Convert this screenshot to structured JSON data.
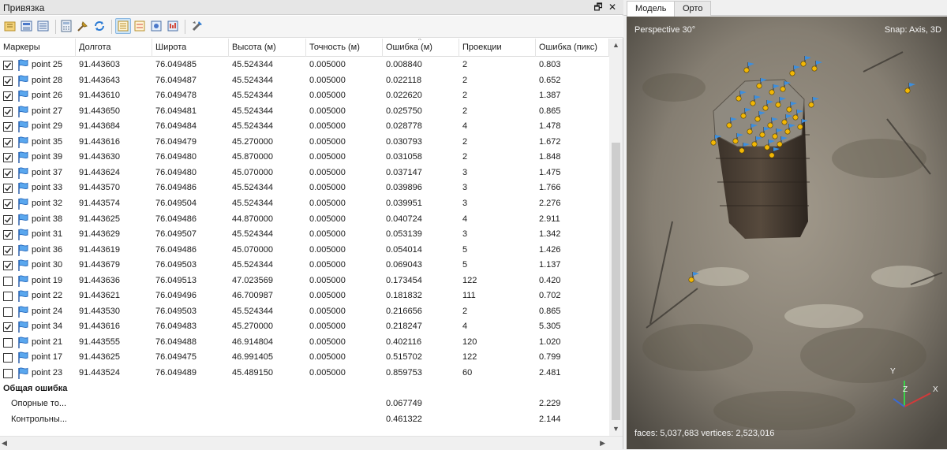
{
  "panel": {
    "title": "Привязка",
    "float_glyph": "🗗",
    "close_glyph": "✕"
  },
  "toolbar": {
    "icons": [
      "import-icon",
      "export-icon",
      "export-markers-icon",
      "calculator-icon",
      "pin-icon",
      "refresh-icon",
      "markers-view-icon",
      "scale-bars-view-icon",
      "cameras-view-icon",
      "view-errors-icon",
      "settings-icon"
    ]
  },
  "table": {
    "columns": [
      "Маркеры",
      "Долгота",
      "Широта",
      "Высота (м)",
      "Точность (м)",
      "Ошибка (м)",
      "Проекции",
      "Ошибка (пикс)"
    ],
    "rows": [
      {
        "checked": true,
        "name": "point 25",
        "lon": "91.443603",
        "lat": "76.049485",
        "alt": "45.524344",
        "acc": "0.005000",
        "err": "0.008840",
        "proj": "2",
        "pix": "0.803"
      },
      {
        "checked": true,
        "name": "point 28",
        "lon": "91.443643",
        "lat": "76.049487",
        "alt": "45.524344",
        "acc": "0.005000",
        "err": "0.022118",
        "proj": "2",
        "pix": "0.652"
      },
      {
        "checked": true,
        "name": "point 26",
        "lon": "91.443610",
        "lat": "76.049478",
        "alt": "45.524344",
        "acc": "0.005000",
        "err": "0.022620",
        "proj": "2",
        "pix": "1.387"
      },
      {
        "checked": true,
        "name": "point 27",
        "lon": "91.443650",
        "lat": "76.049481",
        "alt": "45.524344",
        "acc": "0.005000",
        "err": "0.025750",
        "proj": "2",
        "pix": "0.865"
      },
      {
        "checked": true,
        "name": "point 29",
        "lon": "91.443684",
        "lat": "76.049484",
        "alt": "45.524344",
        "acc": "0.005000",
        "err": "0.028778",
        "proj": "4",
        "pix": "1.478"
      },
      {
        "checked": true,
        "name": "point 35",
        "lon": "91.443616",
        "lat": "76.049479",
        "alt": "45.270000",
        "acc": "0.005000",
        "err": "0.030793",
        "proj": "2",
        "pix": "1.672"
      },
      {
        "checked": true,
        "name": "point 39",
        "lon": "91.443630",
        "lat": "76.049480",
        "alt": "45.870000",
        "acc": "0.005000",
        "err": "0.031058",
        "proj": "2",
        "pix": "1.848"
      },
      {
        "checked": true,
        "name": "point 37",
        "lon": "91.443624",
        "lat": "76.049480",
        "alt": "45.070000",
        "acc": "0.005000",
        "err": "0.037147",
        "proj": "3",
        "pix": "1.475"
      },
      {
        "checked": true,
        "name": "point 33",
        "lon": "91.443570",
        "lat": "76.049486",
        "alt": "45.524344",
        "acc": "0.005000",
        "err": "0.039896",
        "proj": "3",
        "pix": "1.766"
      },
      {
        "checked": true,
        "name": "point 32",
        "lon": "91.443574",
        "lat": "76.049504",
        "alt": "45.524344",
        "acc": "0.005000",
        "err": "0.039951",
        "proj": "3",
        "pix": "2.276"
      },
      {
        "checked": true,
        "name": "point 38",
        "lon": "91.443625",
        "lat": "76.049486",
        "alt": "44.870000",
        "acc": "0.005000",
        "err": "0.040724",
        "proj": "4",
        "pix": "2.911"
      },
      {
        "checked": true,
        "name": "point 31",
        "lon": "91.443629",
        "lat": "76.049507",
        "alt": "45.524344",
        "acc": "0.005000",
        "err": "0.053139",
        "proj": "3",
        "pix": "1.342"
      },
      {
        "checked": true,
        "name": "point 36",
        "lon": "91.443619",
        "lat": "76.049486",
        "alt": "45.070000",
        "acc": "0.005000",
        "err": "0.054014",
        "proj": "5",
        "pix": "1.426"
      },
      {
        "checked": true,
        "name": "point 30",
        "lon": "91.443679",
        "lat": "76.049503",
        "alt": "45.524344",
        "acc": "0.005000",
        "err": "0.069043",
        "proj": "5",
        "pix": "1.137"
      },
      {
        "checked": false,
        "name": "point 19",
        "lon": "91.443636",
        "lat": "76.049513",
        "alt": "47.023569",
        "acc": "0.005000",
        "err": "0.173454",
        "proj": "122",
        "pix": "0.420"
      },
      {
        "checked": false,
        "name": "point 22",
        "lon": "91.443621",
        "lat": "76.049496",
        "alt": "46.700987",
        "acc": "0.005000",
        "err": "0.181832",
        "proj": "111",
        "pix": "0.702"
      },
      {
        "checked": false,
        "name": "point 24",
        "lon": "91.443530",
        "lat": "76.049503",
        "alt": "45.524344",
        "acc": "0.005000",
        "err": "0.216656",
        "proj": "2",
        "pix": "0.865"
      },
      {
        "checked": true,
        "name": "point 34",
        "lon": "91.443616",
        "lat": "76.049483",
        "alt": "45.270000",
        "acc": "0.005000",
        "err": "0.218247",
        "proj": "4",
        "pix": "5.305"
      },
      {
        "checked": false,
        "name": "point 21",
        "lon": "91.443555",
        "lat": "76.049488",
        "alt": "46.914804",
        "acc": "0.005000",
        "err": "0.402116",
        "proj": "120",
        "pix": "1.020"
      },
      {
        "checked": false,
        "name": "point 17",
        "lon": "91.443625",
        "lat": "76.049475",
        "alt": "46.991405",
        "acc": "0.005000",
        "err": "0.515702",
        "proj": "122",
        "pix": "0.799"
      },
      {
        "checked": false,
        "name": "point 23",
        "lon": "91.443524",
        "lat": "76.049489",
        "alt": "45.489150",
        "acc": "0.005000",
        "err": "0.859753",
        "proj": "60",
        "pix": "2.481"
      }
    ],
    "total": {
      "label": "Общая ошибка",
      "control": {
        "label": "Опорные то...",
        "err": "0.067749",
        "pix": "2.229"
      },
      "check": {
        "label": "Контрольны...",
        "err": "0.461322",
        "pix": "2.144"
      }
    }
  },
  "viewer": {
    "tabs": [
      "Модель",
      "Орто"
    ],
    "active_tab": "Модель",
    "perspective": "Perspective 30°",
    "snap": "Snap: Axis, 3D",
    "stats": "faces: 5,037,683 vertices: 2,523,016",
    "axis_labels": {
      "y": "Y",
      "z": "Z",
      "x": "X"
    },
    "colors": {
      "marker_dot": "#f2b705",
      "flag": "#3b8fe0",
      "ground": "#8a8478"
    }
  }
}
